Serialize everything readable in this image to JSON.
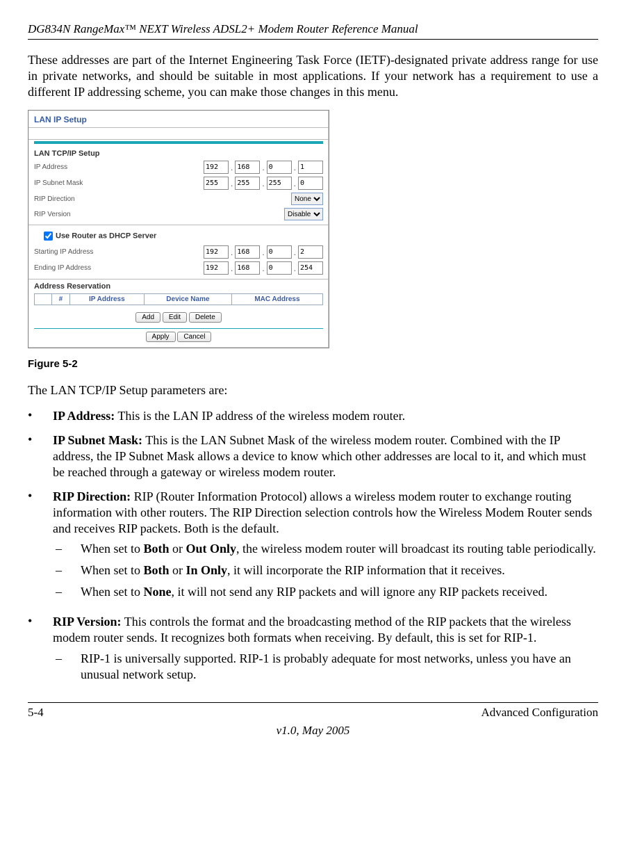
{
  "header": {
    "title": "DG834N RangeMax™ NEXT Wireless ADSL2+ Modem Router Reference Manual"
  },
  "intro": "These addresses are part of the Internet Engineering Task Force (IETF)-designated private address range for use in private networks, and should be suitable in most applications. If your network has a requirement to use a different IP addressing scheme, you can make those changes in this menu.",
  "panel": {
    "title": "LAN IP Setup",
    "tcpip_heading": "LAN TCP/IP Setup",
    "rows": {
      "ip_address_label": "IP Address",
      "ip_address": [
        "192",
        "168",
        "0",
        "1"
      ],
      "subnet_label": "IP Subnet Mask",
      "subnet": [
        "255",
        "255",
        "255",
        "0"
      ],
      "rip_dir_label": "RIP Direction",
      "rip_dir_value": "None",
      "rip_ver_label": "RIP Version",
      "rip_ver_value": "Disable"
    },
    "dhcp_label": "Use Router as DHCP Server",
    "start_ip_label": "Starting IP Address",
    "start_ip": [
      "192",
      "168",
      "0",
      "2"
    ],
    "end_ip_label": "Ending IP Address",
    "end_ip": [
      "192",
      "168",
      "0",
      "254"
    ],
    "reservation_heading": "Address Reservation",
    "columns": {
      "num": "#",
      "ip": "IP Address",
      "dev": "Device Name",
      "mac": "MAC Address"
    },
    "buttons": {
      "add": "Add",
      "edit": "Edit",
      "delete": "Delete",
      "apply": "Apply",
      "cancel": "Cancel"
    }
  },
  "figure_caption": "Figure 5-2",
  "params_intro": "The LAN TCP/IP Setup parameters are:",
  "items": {
    "ip_address": {
      "label": "IP Address:",
      "text": " This is the LAN IP address of the wireless modem router."
    },
    "subnet": {
      "label": "IP Subnet Mask:",
      "text": " This is the LAN Subnet Mask of the wireless modem router. Combined with the IP address, the IP Subnet Mask allows a device to know which other addresses are local to it, and which must be reached through a gateway or wireless modem router."
    },
    "rip_dir": {
      "label": "RIP Direction:",
      "text": " RIP (Router Information Protocol) allows a wireless modem router to exchange routing information with other routers. The RIP Direction selection controls how the Wireless Modem Router sends and receives RIP packets. Both is the default.",
      "sub1_pre": "When set to ",
      "sub1_b1": "Both",
      "sub1_mid": " or ",
      "sub1_b2": "Out Only",
      "sub1_post": ", the wireless modem router will broadcast its routing table periodically.",
      "sub2_pre": "When set to ",
      "sub2_b1": "Both",
      "sub2_mid": " or ",
      "sub2_b2": "In Only",
      "sub2_post": ", it will incorporate the RIP information that it receives.",
      "sub3_pre": "When set to ",
      "sub3_b1": "None",
      "sub3_post": ", it will not send any RIP packets and will ignore any RIP packets received."
    },
    "rip_ver": {
      "label": "RIP Version:",
      "text": " This controls the format and the broadcasting method of the RIP packets that the wireless modem router sends. It recognizes both formats when receiving. By default, this is set for RIP-1.",
      "sub1": "RIP-1 is universally supported. RIP-1 is probably adequate for most networks, unless you have an unusual network setup."
    }
  },
  "footer": {
    "page": "5-4",
    "section": "Advanced Configuration",
    "version": "v1.0, May 2005"
  }
}
